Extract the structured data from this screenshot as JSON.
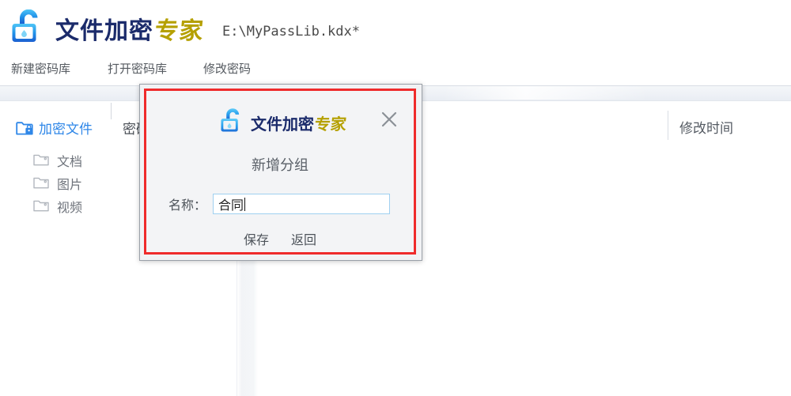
{
  "app": {
    "brand_blue": "文件加密",
    "brand_gold": "专家",
    "file_path": "E:\\MyPassLib.kdx*",
    "logo_icon": "open-padlock-icon"
  },
  "menubar": {
    "items": [
      {
        "label": "新建密码库"
      },
      {
        "label": "打开密码库"
      },
      {
        "label": "修改密码"
      }
    ]
  },
  "left_panel": {
    "tabs": [
      {
        "label": "加密文件",
        "icon": "folder-lock-icon",
        "active": true
      },
      {
        "label": "密码",
        "icon": "key-icon",
        "active": false
      }
    ],
    "tree": [
      {
        "label": "文档",
        "icon": "folder-icon"
      },
      {
        "label": "图片",
        "icon": "folder-icon"
      },
      {
        "label": "视频",
        "icon": "folder-icon"
      }
    ]
  },
  "right_panel": {
    "column_header": "修改时间"
  },
  "dialog": {
    "brand_blue": "文件加密",
    "brand_gold": "专家",
    "logo_icon": "open-padlock-icon",
    "close_icon": "close-icon",
    "title": "新增分组",
    "field_label": "名称：",
    "field_value": "合同",
    "field_placeholder": "",
    "save_label": "保存",
    "back_label": "返回",
    "highlight_color": "#ef2b2b"
  },
  "colors": {
    "accent_blue": "#2f87e8",
    "brand_navy": "#1b2b6b",
    "brand_gold": "#b5a000",
    "highlight_red": "#ef2b2b",
    "text_gray": "#555a60"
  }
}
